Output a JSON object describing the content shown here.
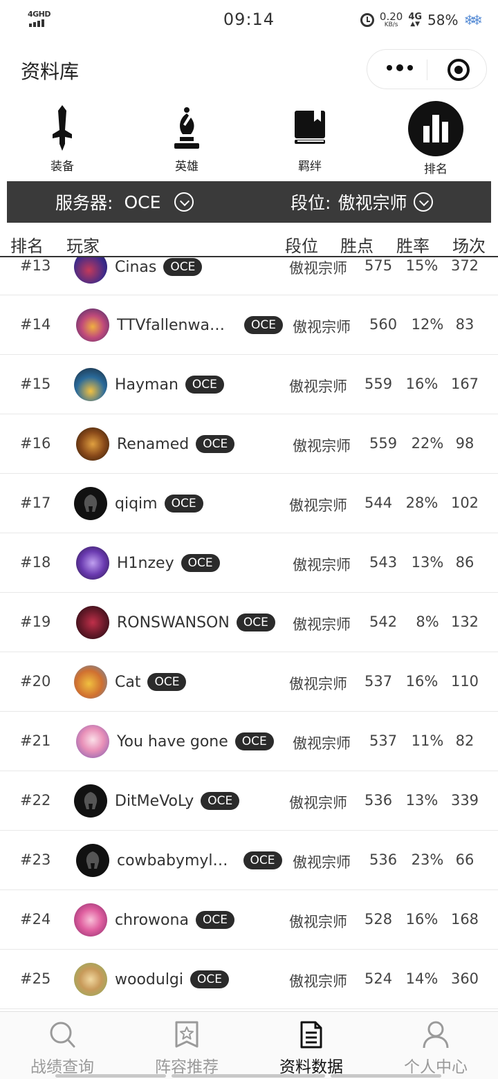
{
  "status_bar": {
    "network": "4GHD",
    "time": "09:14",
    "speed_value": "0.20",
    "speed_unit": "KB/s",
    "signal_2": "4G",
    "battery": "58%"
  },
  "header": {
    "title": "资料库"
  },
  "categories": [
    {
      "label": "装备",
      "icon": "sword-icon"
    },
    {
      "label": "英雄",
      "icon": "chess-bishop-icon"
    },
    {
      "label": "羁绊",
      "icon": "book-icon"
    },
    {
      "label": "排名",
      "icon": "bar-chart-icon",
      "active": true
    }
  ],
  "filters": {
    "server_label": "服务器:",
    "server_value": "OCE",
    "tier_label": "段位:",
    "tier_value": "傲视宗师"
  },
  "table": {
    "headers": [
      "排名",
      "玩家",
      "段位",
      "胜点",
      "胜率",
      "场次"
    ],
    "rows": [
      {
        "rank": "#13",
        "name": "Cinas",
        "region": "OCE",
        "tier": "傲视宗师",
        "lp": "575",
        "winrate": "15%",
        "games": "372"
      },
      {
        "rank": "#14",
        "name": "TTVfallenwall…",
        "region": "OCE",
        "tier": "傲视宗师",
        "lp": "560",
        "winrate": "12%",
        "games": "83"
      },
      {
        "rank": "#15",
        "name": "Hayman",
        "region": "OCE",
        "tier": "傲视宗师",
        "lp": "559",
        "winrate": "16%",
        "games": "167"
      },
      {
        "rank": "#16",
        "name": "Renamed",
        "region": "OCE",
        "tier": "傲视宗师",
        "lp": "559",
        "winrate": "22%",
        "games": "98"
      },
      {
        "rank": "#17",
        "name": "qiqim",
        "region": "OCE",
        "tier": "傲视宗师",
        "lp": "544",
        "winrate": "28%",
        "games": "102"
      },
      {
        "rank": "#18",
        "name": "H1nzey",
        "region": "OCE",
        "tier": "傲视宗师",
        "lp": "543",
        "winrate": "13%",
        "games": "86"
      },
      {
        "rank": "#19",
        "name": "RONSWANSON",
        "region": "OCE",
        "tier": "傲视宗师",
        "lp": "542",
        "winrate": "8%",
        "games": "132"
      },
      {
        "rank": "#20",
        "name": "Cat",
        "region": "OCE",
        "tier": "傲视宗师",
        "lp": "537",
        "winrate": "16%",
        "games": "110"
      },
      {
        "rank": "#21",
        "name": "You have gone",
        "region": "OCE",
        "tier": "傲视宗师",
        "lp": "537",
        "winrate": "11%",
        "games": "82"
      },
      {
        "rank": "#22",
        "name": "DitMeVoLy",
        "region": "OCE",
        "tier": "傲视宗师",
        "lp": "536",
        "winrate": "13%",
        "games": "339"
      },
      {
        "rank": "#23",
        "name": "cowbabymyl…",
        "region": "OCE",
        "tier": "傲视宗师",
        "lp": "536",
        "winrate": "23%",
        "games": "66"
      },
      {
        "rank": "#24",
        "name": "chrowona",
        "region": "OCE",
        "tier": "傲视宗师",
        "lp": "528",
        "winrate": "16%",
        "games": "168"
      },
      {
        "rank": "#25",
        "name": "woodulgi",
        "region": "OCE",
        "tier": "傲视宗师",
        "lp": "524",
        "winrate": "14%",
        "games": "360"
      }
    ]
  },
  "bottom_nav": [
    {
      "label": "战绩查询",
      "icon": "search-icon"
    },
    {
      "label": "阵容推荐",
      "icon": "star-badge-icon"
    },
    {
      "label": "资料数据",
      "icon": "document-icon",
      "active": true
    },
    {
      "label": "个人中心",
      "icon": "user-icon"
    }
  ],
  "colors": {
    "filter_bar_bg": "#3a3a3a",
    "badge_bg": "#2b2b2b",
    "active_icon_bg": "#111111",
    "nav_inactive": "#9a9a9a"
  }
}
